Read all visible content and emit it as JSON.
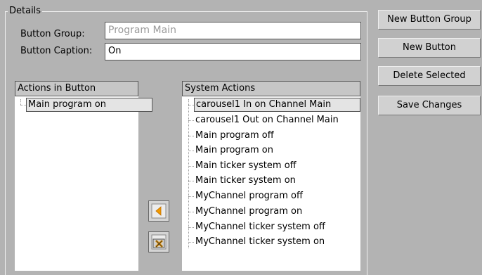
{
  "details": {
    "legend": "Details",
    "button_group_label": "Button Group:",
    "button_group_value": "Program Main",
    "button_caption_label": "Button Caption:",
    "button_caption_value": "On"
  },
  "actions_in_button": {
    "header": "Actions in Button",
    "items": [
      "Main program on"
    ],
    "selected_index": 0
  },
  "system_actions": {
    "header": "System Actions",
    "items": [
      "carousel1 In on Channel Main",
      "carousel1 Out on Channel Main",
      "Main program off",
      "Main program on",
      "Main ticker system off",
      "Main ticker system on",
      "MyChannel program off",
      "MyChannel program on",
      "MyChannel ticker system off",
      "MyChannel ticker system on"
    ],
    "selected_index": 0
  },
  "buttons": {
    "new_button_group": "New Button Group",
    "new_button": "New Button",
    "delete_selected": "Delete Selected",
    "save_changes": "Save Changes"
  },
  "icons": {
    "move_left": "arrow-left-icon",
    "remove": "delete-x-icon"
  },
  "colors": {
    "background": "#b3b3b3",
    "arrow": "#f29a00",
    "delete_x": "#f29a00"
  }
}
